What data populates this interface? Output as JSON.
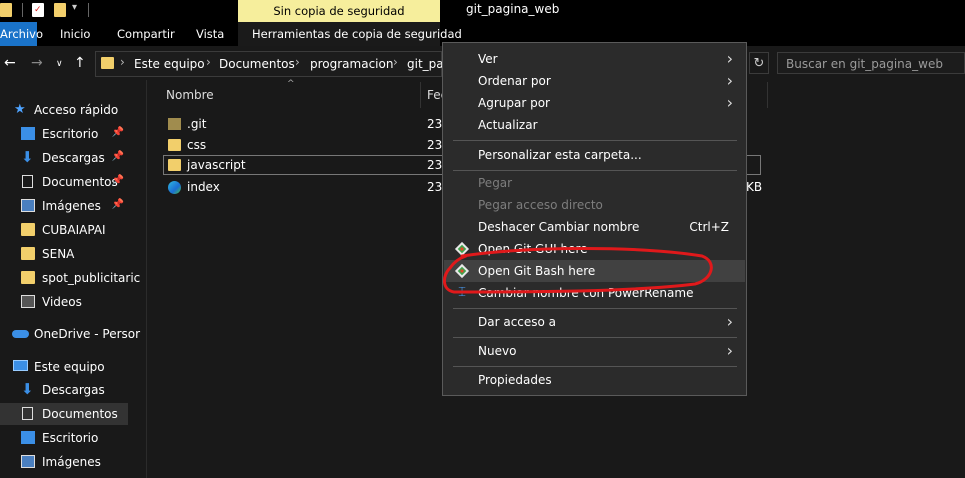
{
  "window": {
    "title": "git_pagina_web"
  },
  "ribbon": {
    "contextual_header": "Sin copia de seguridad",
    "tabs": [
      "Archivo",
      "Inicio",
      "Compartir",
      "Vista",
      "Herramientas de copia de seguridad"
    ]
  },
  "address": {
    "crumbs": [
      "Este equipo",
      "Documentos",
      "programacion",
      "git_pag"
    ]
  },
  "search": {
    "placeholder": "Buscar en git_pagina_web"
  },
  "sidebar": {
    "items": [
      {
        "label": "Acceso rápido",
        "icon": "star-icon"
      },
      {
        "label": "Escritorio",
        "icon": "desktop-icon",
        "pinned": true
      },
      {
        "label": "Descargas",
        "icon": "download-icon",
        "pinned": true
      },
      {
        "label": "Documentos",
        "icon": "document-icon",
        "pinned": true
      },
      {
        "label": "Imágenes",
        "icon": "image-icon",
        "pinned": true
      },
      {
        "label": "CUBAIAPAI",
        "icon": "folder-icon"
      },
      {
        "label": "SENA",
        "icon": "folder-icon"
      },
      {
        "label": "spot_publicitaric",
        "icon": "folder-icon"
      },
      {
        "label": "Videos",
        "icon": "video-icon"
      },
      {
        "label": "OneDrive - Persor",
        "icon": "cloud-icon"
      },
      {
        "label": "Este equipo",
        "icon": "computer-icon"
      },
      {
        "label": "Descargas",
        "icon": "download-icon"
      },
      {
        "label": "Documentos",
        "icon": "document-icon"
      },
      {
        "label": "Escritorio",
        "icon": "desktop-icon"
      },
      {
        "label": "Imágenes",
        "icon": "image-icon"
      }
    ]
  },
  "filelist": {
    "columns": [
      "Nombre",
      "Fec"
    ],
    "files": [
      {
        "name": ".git",
        "date": "23/"
      },
      {
        "name": "css",
        "date": "23/"
      },
      {
        "name": "javascript",
        "date": "23/"
      },
      {
        "name": "index",
        "date": "23/",
        "size_fragment": "KB"
      }
    ]
  },
  "context_menu": {
    "items": [
      {
        "label": "Ver",
        "submenu": true
      },
      {
        "label": "Ordenar por",
        "submenu": true
      },
      {
        "label": "Agrupar por",
        "submenu": true
      },
      {
        "label": "Actualizar"
      },
      {
        "label": "Personalizar esta carpeta..."
      },
      {
        "label": "Pegar",
        "disabled": true
      },
      {
        "label": "Pegar acceso directo",
        "disabled": true
      },
      {
        "label": "Deshacer Cambiar nombre",
        "shortcut": "Ctrl+Z"
      },
      {
        "label": "Open Git GUI here",
        "icon": "git-icon"
      },
      {
        "label": "Open Git Bash here",
        "icon": "git-icon",
        "highlighted": true
      },
      {
        "label": "Cambiar nombre con PowerRename",
        "icon": "powerrename-icon"
      },
      {
        "label": "Dar acceso a",
        "submenu": true
      },
      {
        "label": "Nuevo",
        "submenu": true
      },
      {
        "label": "Propiedades"
      }
    ]
  },
  "colors": {
    "annotation": "#e0191b",
    "folder": "#f2cf6b",
    "accent_tab": "#1a73c9"
  }
}
